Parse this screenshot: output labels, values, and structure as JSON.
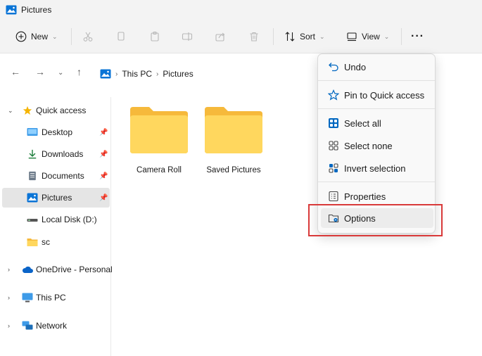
{
  "window": {
    "title": "Pictures"
  },
  "toolbar": {
    "new_label": "New",
    "sort_label": "Sort",
    "view_label": "View",
    "more_label": "···"
  },
  "address": {
    "segments": [
      "This PC",
      "Pictures"
    ]
  },
  "sidebar": {
    "quick_access": "Quick access",
    "items": [
      {
        "label": "Desktop"
      },
      {
        "label": "Downloads"
      },
      {
        "label": "Documents"
      },
      {
        "label": "Pictures"
      },
      {
        "label": "Local Disk (D:)"
      },
      {
        "label": "sc"
      }
    ],
    "onedrive": "OneDrive - Personal",
    "thispc": "This PC",
    "network": "Network"
  },
  "folders": [
    {
      "name": "Camera Roll"
    },
    {
      "name": "Saved Pictures"
    }
  ],
  "menu": {
    "items": [
      {
        "label": "Undo"
      },
      {
        "label": "Pin to Quick access"
      },
      {
        "label": "Select all"
      },
      {
        "label": "Select none"
      },
      {
        "label": "Invert selection"
      },
      {
        "label": "Properties"
      },
      {
        "label": "Options"
      }
    ]
  },
  "colors": {
    "accent": "#0067c0",
    "folder_front": "#ffd75e",
    "folder_back": "#f6b93b",
    "highlight": "#d93a3a"
  }
}
